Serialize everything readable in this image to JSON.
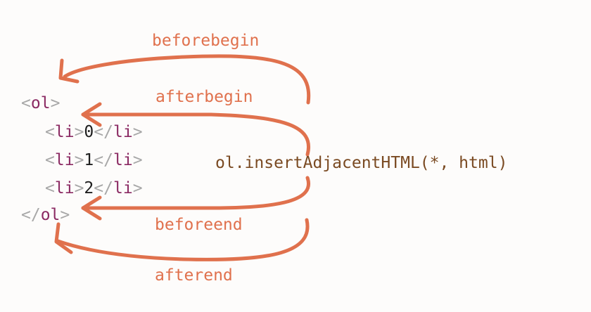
{
  "colors": {
    "arrow": "#e0714d",
    "label": "#e0714d",
    "method": "#7a4a22",
    "bracket": "#a8a8a8",
    "tag": "#8b2a63",
    "text": "#1e1e1e"
  },
  "code": {
    "ol_open": {
      "lt": "<",
      "name": "ol",
      "gt": ">"
    },
    "items": [
      {
        "open_lt": "<",
        "open_name": "li",
        "open_gt": ">",
        "value": "0",
        "close_lt": "</",
        "close_name": "li",
        "close_gt": ">"
      },
      {
        "open_lt": "<",
        "open_name": "li",
        "open_gt": ">",
        "value": "1",
        "close_lt": "</",
        "close_name": "li",
        "close_gt": ">"
      },
      {
        "open_lt": "<",
        "open_name": "li",
        "open_gt": ">",
        "value": "2",
        "close_lt": "</",
        "close_name": "li",
        "close_gt": ">"
      }
    ],
    "ol_close": {
      "lt": "</",
      "name": "ol",
      "gt": ">"
    }
  },
  "positions": {
    "beforebegin": "beforebegin",
    "afterbegin": "afterbegin",
    "beforeend": "beforeend",
    "afterend": "afterend"
  },
  "method": "ol.insertAdjacentHTML(*, html)"
}
